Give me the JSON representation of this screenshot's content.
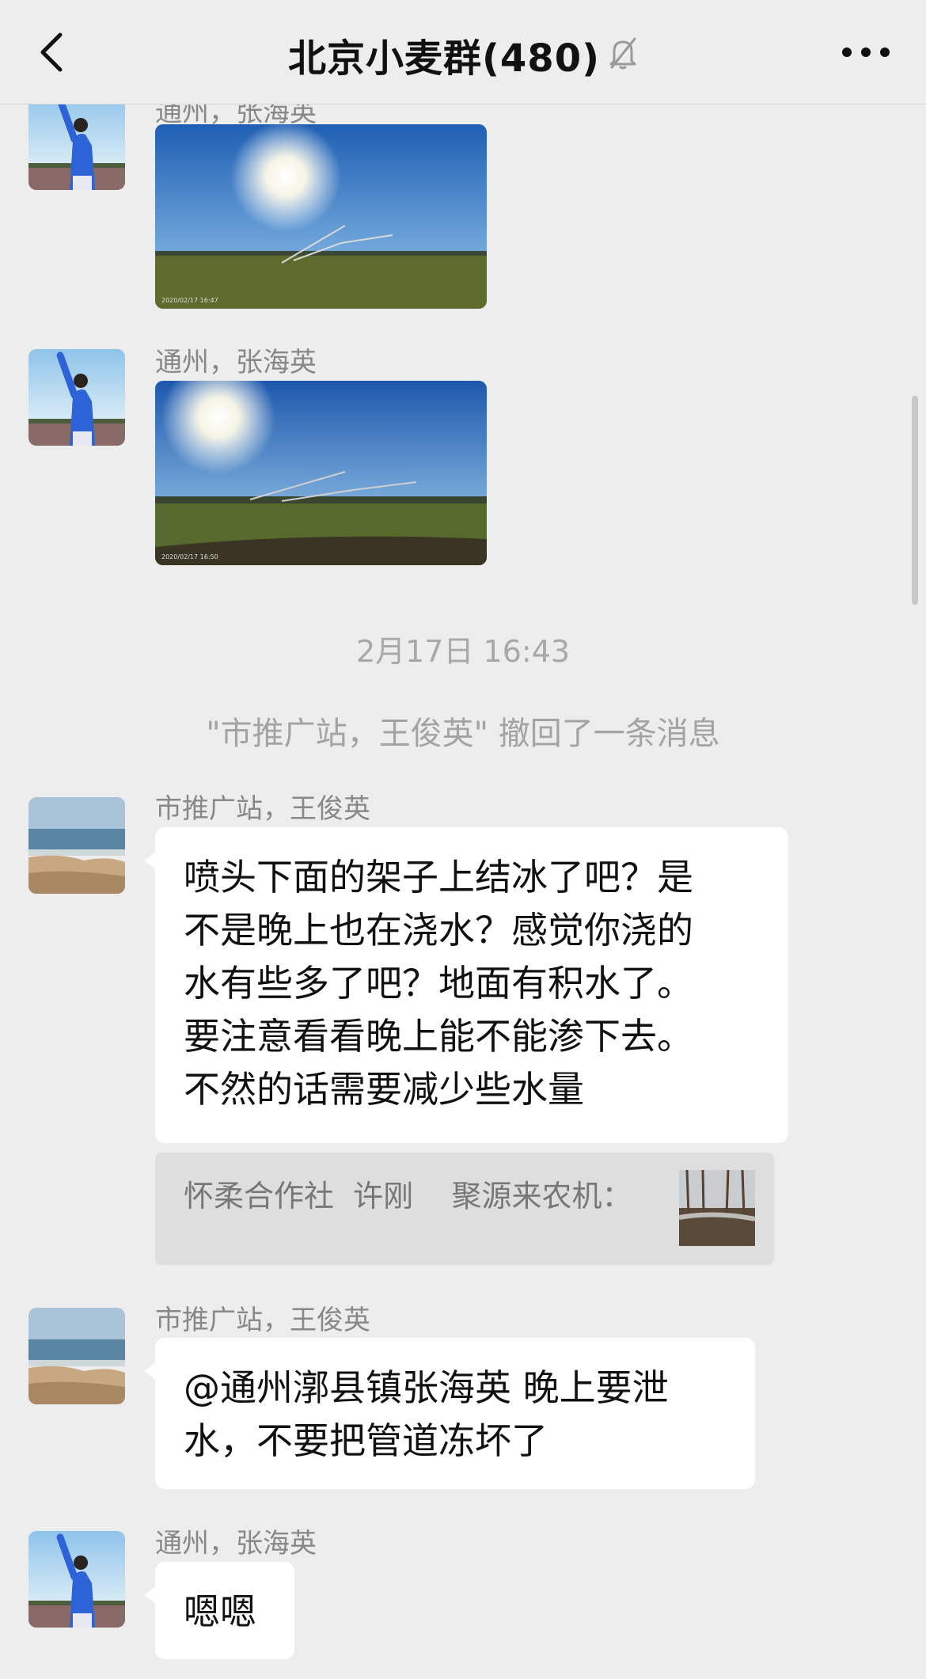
{
  "header": {
    "title": "北京小麦群(480)",
    "muted_icon": "bell-slash-icon",
    "back_icon": "chevron-left-icon",
    "more_icon": "more-dots-icon"
  },
  "messages": [
    {
      "sender": "通州，张海英",
      "type": "image",
      "image": "field-irrigation-photo",
      "caption": "2020/02/17 16:47"
    },
    {
      "sender": "通州，张海英",
      "type": "image",
      "image": "field-irrigation-photo",
      "caption": "2020/02/17 16:50"
    }
  ],
  "timestamp": "2月17日 16:43",
  "system_message": "\"市推广站，王俊英\" 撤回了一条消息",
  "text_messages": [
    {
      "sender": "市推广站，王俊英",
      "lines": [
        "喷头下面的架子上结冰了吧？是",
        "不是晚上也在浇水？感觉你浇的",
        "水有些多了吧？地面有积水了。",
        "要注意看看晚上能不能渗下去。",
        "不然的话需要减少些水量"
      ]
    },
    {
      "sender": "市推广站，王俊英",
      "lines": [
        "@通州漷县镇张海英 晚上要泄",
        "水，不要把管道冻坏了"
      ]
    },
    {
      "sender": "通州，张海英",
      "lines": [
        "嗯嗯"
      ]
    }
  ],
  "quote": {
    "text": "怀柔合作社  许刚    聚源来农机：",
    "thumb": "field-sprinkler-thumbnail"
  },
  "colors": {
    "background": "#ededed",
    "bubble": "#ffffff",
    "sender": "#888888",
    "system": "#a3a3a3"
  }
}
